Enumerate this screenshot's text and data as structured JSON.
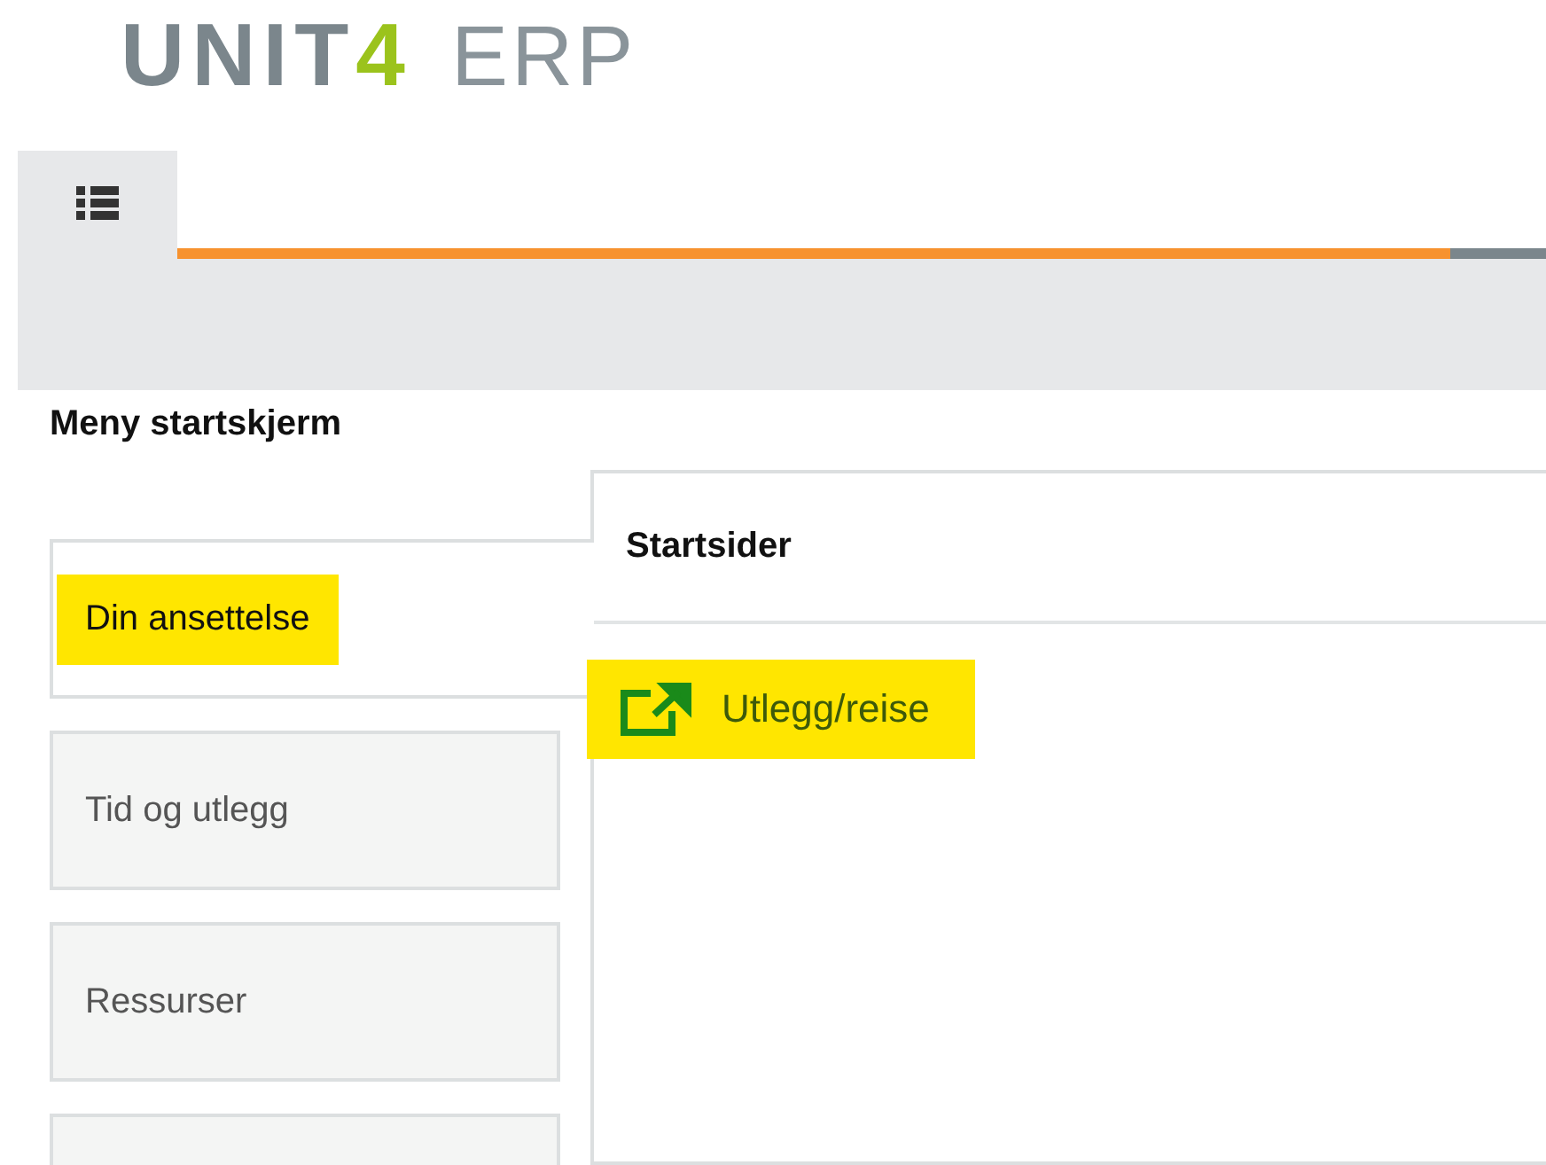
{
  "logo": {
    "brand": "UNIT",
    "mark": "4",
    "product": "ERP"
  },
  "tab_bar": {
    "tabs": [
      {
        "kind": "menu",
        "selected": true
      }
    ],
    "progress": {
      "level": 0.93
    }
  },
  "sidebar": {
    "title": "Meny startskjerm",
    "items": [
      {
        "label": "Din ansettelse",
        "selected": true,
        "highlighted": true
      },
      {
        "label": "Tid og utlegg",
        "selected": false,
        "highlighted": false
      },
      {
        "label": "Ressurser",
        "selected": false,
        "highlighted": false
      },
      {
        "selected": false
      }
    ]
  },
  "panel": {
    "title": "Startsider",
    "links": [
      {
        "label": "Utlegg/reise",
        "highlighted": true
      }
    ]
  }
}
